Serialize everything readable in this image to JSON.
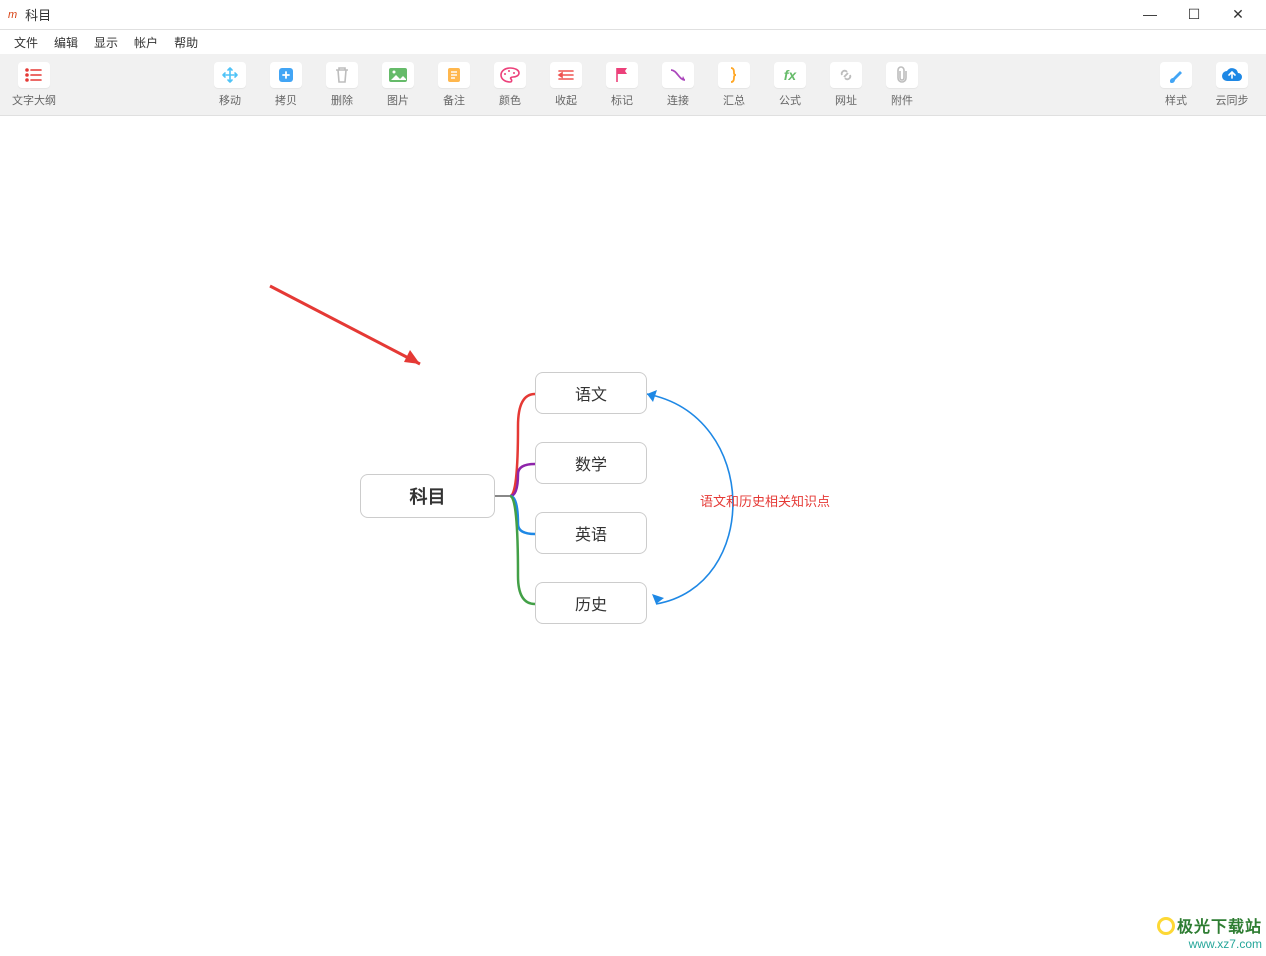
{
  "window": {
    "title": "科目",
    "app_icon_letter": "m"
  },
  "menu": {
    "file": "文件",
    "edit": "编辑",
    "view": "显示",
    "account": "帐户",
    "help": "帮助"
  },
  "toolbar": {
    "outline": "文字大纲",
    "move": "移动",
    "copy": "拷贝",
    "delete": "删除",
    "image": "图片",
    "note": "备注",
    "color": "颜色",
    "collapse": "收起",
    "mark": "标记",
    "connect": "连接",
    "summary": "汇总",
    "formula": "公式",
    "url": "网址",
    "attachment": "附件",
    "style": "样式",
    "cloud": "云同步"
  },
  "mindmap": {
    "root": "科目",
    "children": [
      "语文",
      "数学",
      "英语",
      "历史"
    ],
    "annotation": "语文和历史相关知识点"
  },
  "watermark": {
    "brand": "极光下载站",
    "url": "www.xz7.com"
  }
}
